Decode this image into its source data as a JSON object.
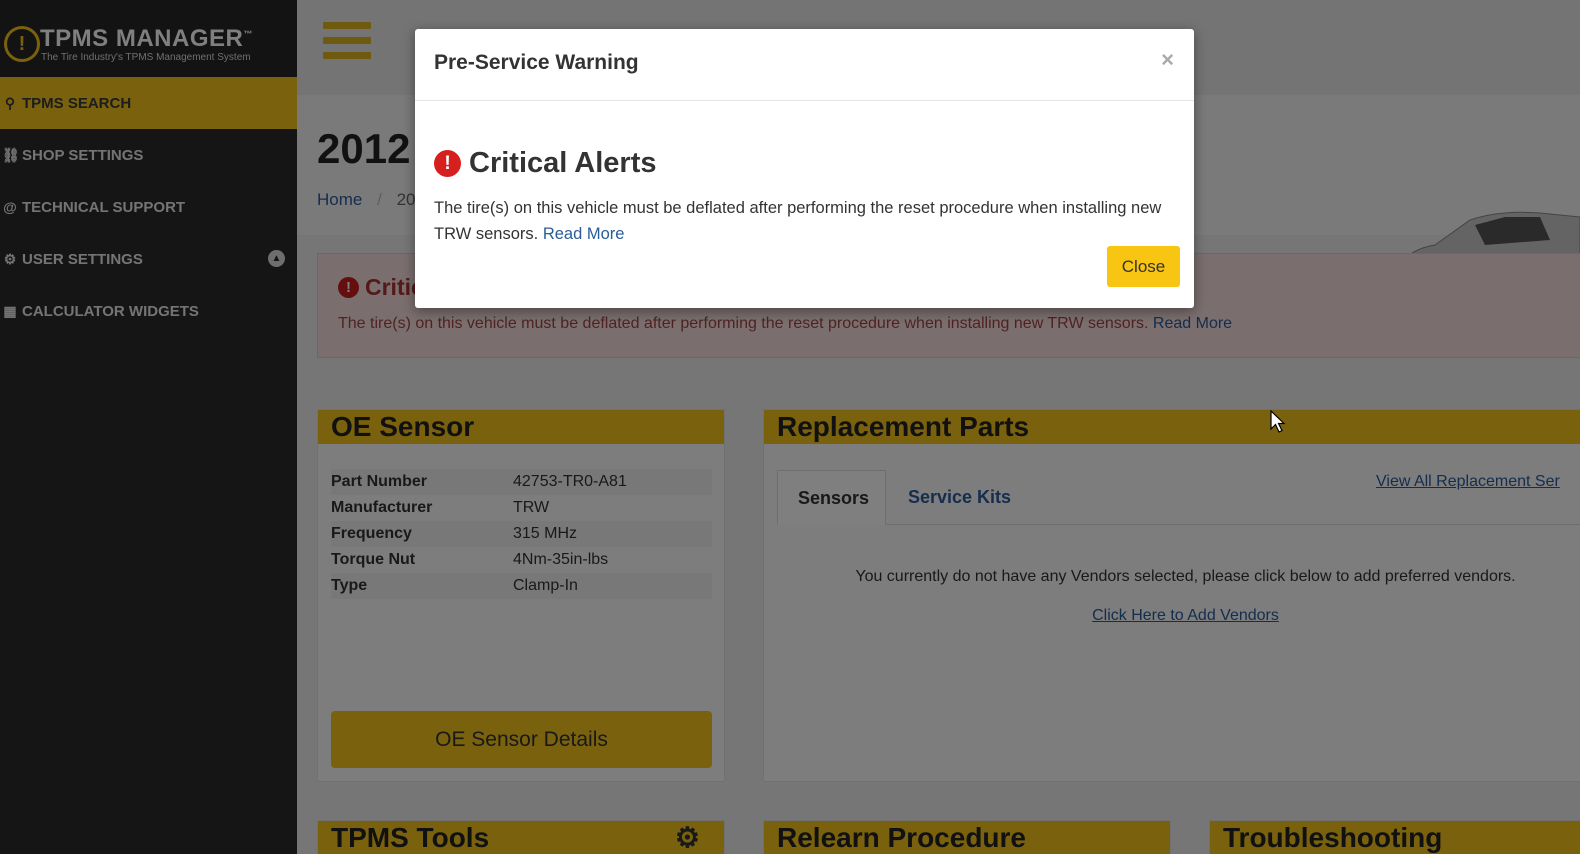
{
  "sidebar": {
    "logo_mark": "!",
    "logo_title": "TPMS MANAGER",
    "logo_tm": "™",
    "logo_subtitle": "The Tire Industry's TPMS Management System",
    "items": [
      {
        "label": "TPMS SEARCH",
        "icon": "search-icon",
        "active": true
      },
      {
        "label": "SHOP SETTINGS",
        "icon": "car-icon"
      },
      {
        "label": "TECHNICAL SUPPORT",
        "icon": "at-icon"
      },
      {
        "label": "USER SETTINGS",
        "icon": "gear-icon"
      },
      {
        "label": "CALCULATOR WIDGETS",
        "icon": "calculator-icon"
      }
    ]
  },
  "page": {
    "year_title": "2012",
    "breadcrumb_home": "Home",
    "breadcrumb_sep": "/",
    "breadcrumb_current": "201"
  },
  "alert": {
    "heading": "Critic",
    "text": "The tire(s) on this vehicle must be deflated after performing the reset procedure when installing new TRW sensors.",
    "link": "Read More"
  },
  "oe_sensor": {
    "title": "OE Sensor",
    "rows": [
      {
        "key": "Part Number",
        "value": "42753-TR0-A81"
      },
      {
        "key": "Manufacturer",
        "value": "TRW"
      },
      {
        "key": "Frequency",
        "value": "315 MHz"
      },
      {
        "key": "Torque Nut",
        "value": "4Nm-35in-lbs"
      },
      {
        "key": "Type",
        "value": "Clamp-In"
      }
    ],
    "button": "OE Sensor Details"
  },
  "replacement": {
    "title": "Replacement Parts",
    "tabs": [
      "Sensors",
      "Service Kits"
    ],
    "view_all": "View All Replacement Ser",
    "message": "You currently do not have any Vendors selected, please click below to add preferred vendors.",
    "add_link": "Click Here to Add Vendors"
  },
  "bottom_panels": {
    "tools": "TPMS Tools",
    "relearn": "Relearn Procedure",
    "troubleshooting": "Troubleshooting"
  },
  "modal": {
    "title": "Pre-Service Warning",
    "close_x": "×",
    "alert_title": "Critical Alerts",
    "body": "The tire(s) on this vehicle must be deflated after performing the reset procedure when installing new TRW sensors.",
    "read_more": "Read More",
    "close_button": "Close"
  },
  "colors": {
    "accent": "#f2c21b",
    "sidebar": "#2b2b2b",
    "danger": "#d61f1f",
    "link": "#2a5c9a"
  }
}
